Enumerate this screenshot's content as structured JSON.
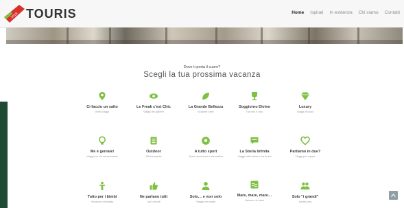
{
  "header": {
    "logo_text": "TOURIS",
    "logo_badge": "2018",
    "nav": [
      {
        "label": "Home",
        "active": true
      },
      {
        "label": "Ispirati",
        "active": false
      },
      {
        "label": "In evidenza",
        "active": false
      },
      {
        "label": "Chi siamo",
        "active": false
      },
      {
        "label": "Contatti",
        "active": false
      }
    ]
  },
  "section": {
    "pre_title": "Dove ti porta il cuore?",
    "title": "Scegli la tua prossima vacanza"
  },
  "colors": {
    "accent": "#7dc142",
    "side_bar": "#1f4a35",
    "logo_red": "#d8312b"
  },
  "rows": [
    [
      {
        "title": "Ci faccio un salto",
        "sub": "Brevi viaggi",
        "icon": "map-pin-icon"
      },
      {
        "title": "Le Freak c'est Chic",
        "sub": "Viaggi del piacere",
        "icon": "eye-icon"
      },
      {
        "title": "La Grande Bellezza",
        "sub": "Scoprire l'arte",
        "icon": "leaf-icon"
      },
      {
        "title": "Soggiorno Divino",
        "sub": "Tra vino e cibo",
        "icon": "trophy-icon"
      },
      {
        "title": "Luxury",
        "sub": "Viaggi di lusso",
        "icon": "diamond-icon"
      }
    ],
    [
      {
        "title": "Me è geniale!",
        "sub": "Viaggi per chi ama pensare",
        "icon": "lightbulb-icon"
      },
      {
        "title": "Outdoor",
        "sub": "All'aria aperta",
        "icon": "book-icon"
      },
      {
        "title": "A tutto sport",
        "sub": "Sport, avventura e adrenalina",
        "icon": "soccer-ball-icon"
      },
      {
        "title": "La Storia Infinita",
        "sub": "Viaggi nella storia e tra le arti",
        "icon": "chat-bubble-icon"
      },
      {
        "title": "Partiamo in due?",
        "sub": "Viaggi per coppie",
        "icon": "heart-icon"
      }
    ],
    [
      {
        "title": "Tutto per i bimbi",
        "sub": "Vacanze in famiglia",
        "icon": "child-icon"
      },
      {
        "title": "Ne parlano tutti",
        "sub": "I più cercati",
        "icon": "thumbs-up-icon"
      },
      {
        "title": "Solo… e non solo",
        "sub": "Viaggi per single",
        "icon": "person-icon"
      },
      {
        "title": "Mare, mare, mare…",
        "sub": "Vacanze al mare",
        "icon": "wave-icon"
      },
      {
        "title": "Solo \"i grandi\"",
        "sub": "Adults only",
        "icon": "group-icon"
      }
    ]
  ]
}
